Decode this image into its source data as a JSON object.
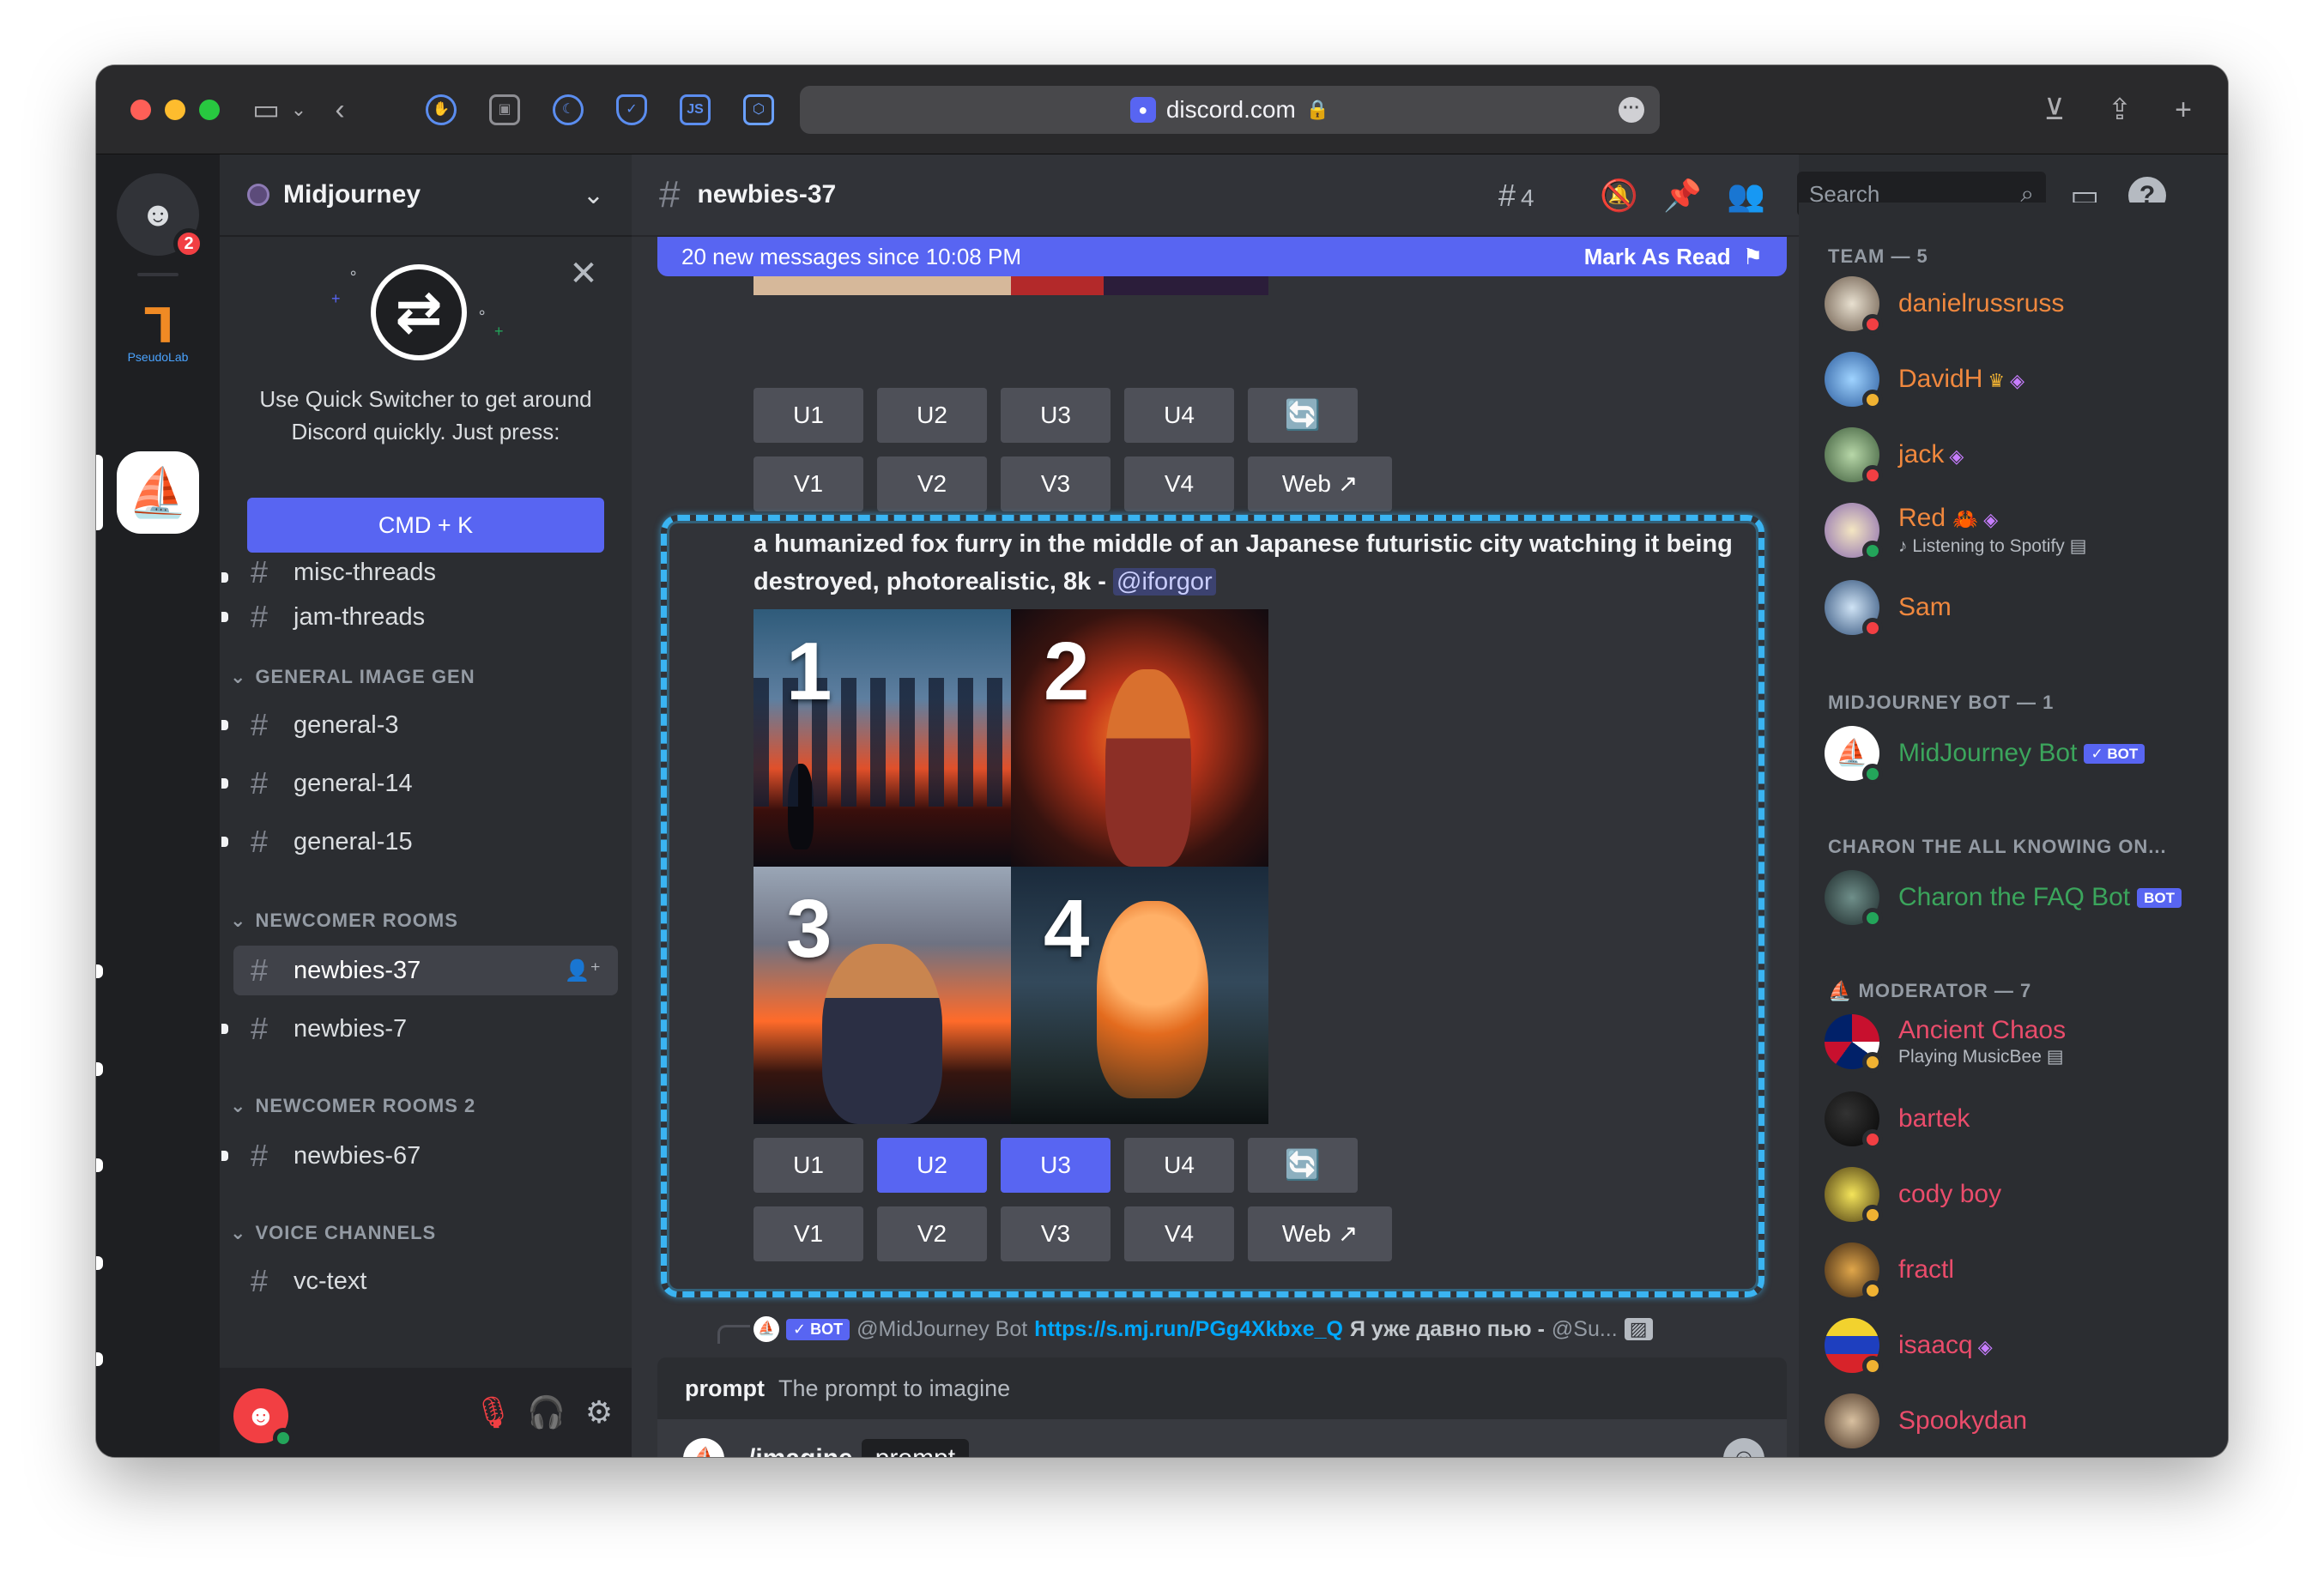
{
  "browser": {
    "url": "discord.com"
  },
  "server": {
    "name": "Midjourney",
    "notification_count": "2",
    "pseudolab_caption": "PseudoLab"
  },
  "quick_switcher": {
    "text": "Use Quick Switcher to get around Discord quickly. Just press:",
    "button": "CMD + K"
  },
  "channels": {
    "misc_threads": "misc-threads",
    "jam_threads": "jam-threads",
    "cat_general": "GENERAL IMAGE GEN",
    "general_3": "general-3",
    "general_14": "general-14",
    "general_15": "general-15",
    "cat_newcomer": "NEWCOMER ROOMS",
    "newbies_37": "newbies-37",
    "newbies_7": "newbies-7",
    "cat_newcomer2": "NEWCOMER ROOMS 2",
    "newbies_67": "newbies-67",
    "cat_voice": "VOICE CHANNELS",
    "vc_text": "vc-text"
  },
  "chat": {
    "channel_title": "newbies-37",
    "thread_count": "4",
    "new_messages": "20 new messages since 10:08 PM",
    "mark_as_read": "Mark As Read",
    "prompt_text": "a humanized fox furry in the middle of an Japanese futuristic city watching it being destroyed, photorealistic, 8k - ",
    "prompt_mention": "@iforgor",
    "tile_numbers": [
      "1",
      "2",
      "3",
      "4"
    ],
    "buttons_u": [
      "U1",
      "U2",
      "U3",
      "U4"
    ],
    "buttons_v": [
      "V1",
      "V2",
      "V3",
      "V4"
    ],
    "web_label": "Web",
    "reply": {
      "bot_tag": "BOT",
      "author": "@MidJourney Bot",
      "link": "https://s.mj.run/PGg4Xkbxe_Q",
      "message": "Я уже давно пью - ",
      "mention": "@Su..."
    },
    "hint_option": "prompt",
    "hint_desc": "The prompt to imagine",
    "composer_command": "/imagine",
    "composer_option": "prompt"
  },
  "search": {
    "placeholder": "Search"
  },
  "members": {
    "cat_team": "TEAM — 5",
    "team": [
      {
        "name": "danielrussruss",
        "color": "#f0883e"
      },
      {
        "name": "DavidH",
        "color": "#f0883e"
      },
      {
        "name": "jack",
        "color": "#f0883e"
      },
      {
        "name": "Red",
        "color": "#f0883e",
        "sub": "Listening to Spotify"
      },
      {
        "name": "Sam",
        "color": "#f0883e"
      }
    ],
    "cat_bot": "MIDJOURNEY BOT — 1",
    "bot_name": "MidJourney Bot",
    "cat_charon": "CHARON THE ALL KNOWING ON...",
    "charon_name": "Charon the FAQ Bot",
    "bot_badge": "BOT",
    "cat_mod": "MODERATOR — 7",
    "mods": [
      {
        "name": "Ancient Chaos",
        "sub": "Playing MusicBee"
      },
      {
        "name": "bartek"
      },
      {
        "name": "cody boy"
      },
      {
        "name": "fractl"
      },
      {
        "name": "isaacq"
      },
      {
        "name": "Spookydan"
      }
    ],
    "colors": {
      "team": "#f0883e",
      "bot": "#3ba55c",
      "mod": "#ea4c6b"
    }
  }
}
